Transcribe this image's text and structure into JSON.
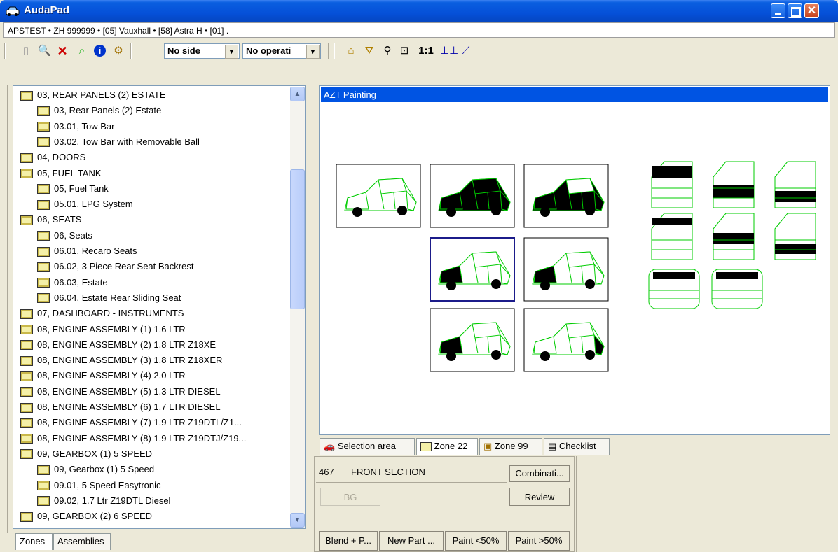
{
  "window": {
    "title": "AudaPad"
  },
  "pathbar": {
    "text": "APSTEST • ZH 999999 • [05] Vauxhall • [58] Astra H • [01] ."
  },
  "toolbar": {
    "side_select": "No side",
    "operation_select": "No operati",
    "ratio_label": "1:1"
  },
  "tree": {
    "items": [
      {
        "label": "03, REAR PANELS (2) ESTATE",
        "level": 0
      },
      {
        "label": "03, Rear Panels (2) Estate",
        "level": 1
      },
      {
        "label": "03.01, Tow Bar",
        "level": 1
      },
      {
        "label": "03.02, Tow Bar with Removable Ball",
        "level": 1
      },
      {
        "label": "04, DOORS",
        "level": 0
      },
      {
        "label": "05, FUEL TANK",
        "level": 0
      },
      {
        "label": "05, Fuel Tank",
        "level": 1
      },
      {
        "label": "05.01, LPG System",
        "level": 1
      },
      {
        "label": "06, SEATS",
        "level": 0
      },
      {
        "label": "06, Seats",
        "level": 1
      },
      {
        "label": "06.01, Recaro Seats",
        "level": 1
      },
      {
        "label": "06.02, 3 Piece Rear Seat Backrest",
        "level": 1
      },
      {
        "label": "06.03, Estate",
        "level": 1
      },
      {
        "label": "06.04, Estate Rear Sliding Seat",
        "level": 1
      },
      {
        "label": "07, DASHBOARD - INSTRUMENTS",
        "level": 0
      },
      {
        "label": "08, ENGINE ASSEMBLY (1) 1.6 LTR",
        "level": 0
      },
      {
        "label": "08, ENGINE ASSEMBLY (2) 1.8 LTR Z18XE",
        "level": 0
      },
      {
        "label": "08, ENGINE ASSEMBLY (3) 1.8 LTR Z18XER",
        "level": 0
      },
      {
        "label": "08, ENGINE ASSEMBLY (4) 2.0 LTR",
        "level": 0
      },
      {
        "label": "08, ENGINE ASSEMBLY (5) 1.3 LTR DIESEL",
        "level": 0
      },
      {
        "label": "08, ENGINE ASSEMBLY (6) 1.7 LTR DIESEL",
        "level": 0
      },
      {
        "label": "08, ENGINE ASSEMBLY (7) 1.9 LTR Z19DTL/Z1...",
        "level": 0
      },
      {
        "label": "08, ENGINE ASSEMBLY (8) 1.9 LTR Z19DTJ/Z19...",
        "level": 0
      },
      {
        "label": "09, GEARBOX (1) 5 SPEED",
        "level": 0
      },
      {
        "label": "09, Gearbox (1) 5 Speed",
        "level": 1
      },
      {
        "label": "09.01, 5 Speed Easytronic",
        "level": 1
      },
      {
        "label": "09.02, 1.7 Ltr Z19DTL Diesel",
        "level": 1
      },
      {
        "label": "09, GEARBOX (2) 6 SPEED",
        "level": 0
      }
    ]
  },
  "left_tabs": [
    "Zones",
    "Assemblies"
  ],
  "azt": {
    "header": "AZT Painting"
  },
  "right_tabs": [
    "Selection area",
    "Zone 22",
    "Zone 99",
    "Checklist"
  ],
  "bottom": {
    "zone_code": "467",
    "zone_name": "FRONT SECTION",
    "combination_button": "Combinati...",
    "bg_button": "BG",
    "review_button": "Review",
    "op_buttons": [
      "Blend + P...",
      "New Part ...",
      "Paint <50%",
      "Paint >50%"
    ]
  },
  "colors": {
    "accent_blue": "#0054e3",
    "line_green": "#00cc00"
  }
}
